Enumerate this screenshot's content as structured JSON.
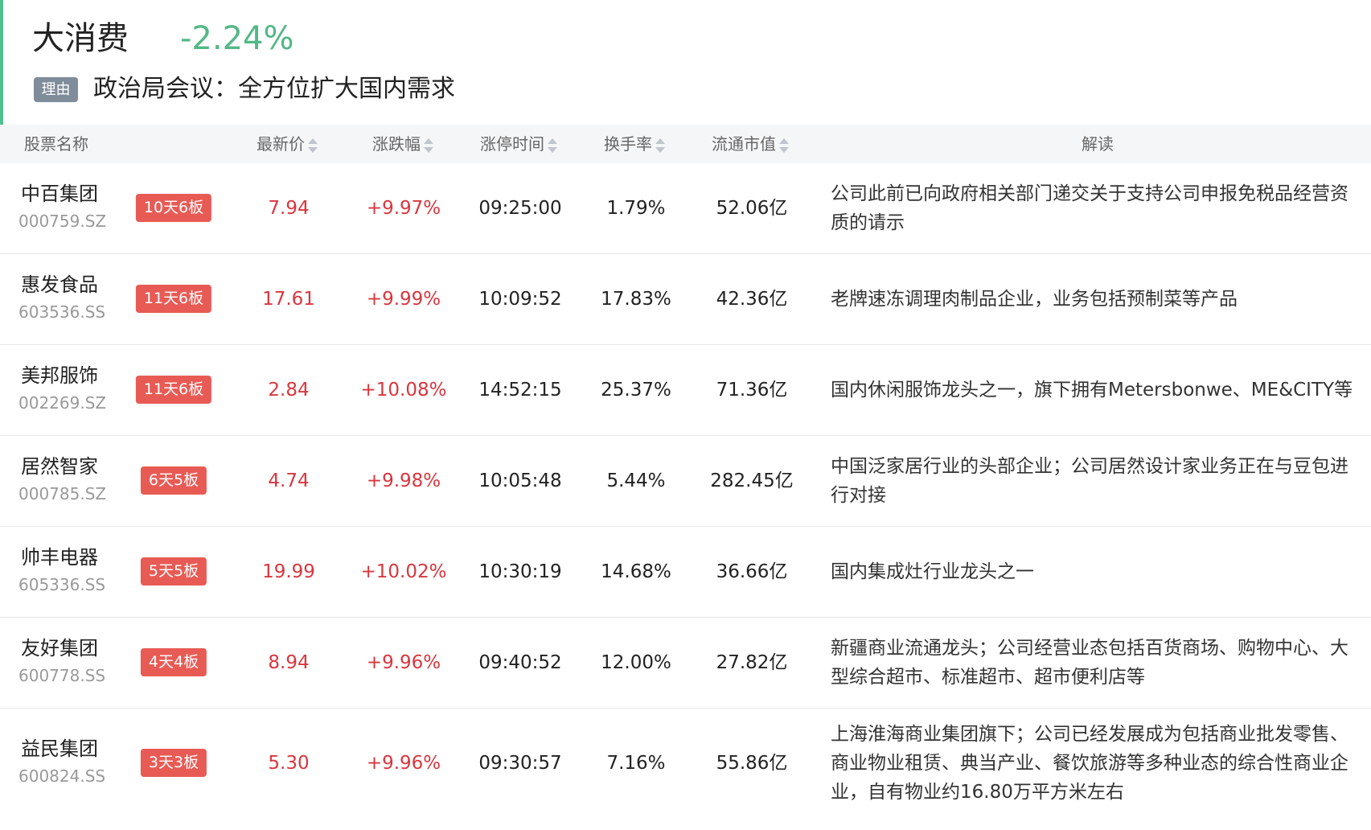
{
  "header": {
    "title": "大消费",
    "change": "-2.24%",
    "reason_tag": "理由",
    "reason": "政治局会议：全方位扩大国内需求"
  },
  "colors": {
    "accent_green": "#4fc08d",
    "down_green": "#52b886",
    "up_red": "#d9363e",
    "badge_red": "#e85b55",
    "tag_gray": "#7f8c9a"
  },
  "table": {
    "columns": {
      "name": "股票名称",
      "price": "最新价",
      "change": "涨跌幅",
      "limit_time": "涨停时间",
      "turnover": "换手率",
      "float_cap": "流通市值",
      "explain": "解读"
    },
    "rows": [
      {
        "name": "中百集团",
        "code": "000759.SZ",
        "badge": "10天6板",
        "price": "7.94",
        "change": "+9.97%",
        "limit_time": "09:25:00",
        "turnover": "1.79%",
        "float_cap": "52.06亿",
        "explain": "公司此前已向政府相关部门递交关于支持公司申报免税品经营资质的请示"
      },
      {
        "name": "惠发食品",
        "code": "603536.SS",
        "badge": "11天6板",
        "price": "17.61",
        "change": "+9.99%",
        "limit_time": "10:09:52",
        "turnover": "17.83%",
        "float_cap": "42.36亿",
        "explain": "老牌速冻调理肉制品企业，业务包括预制菜等产品"
      },
      {
        "name": "美邦服饰",
        "code": "002269.SZ",
        "badge": "11天6板",
        "price": "2.84",
        "change": "+10.08%",
        "limit_time": "14:52:15",
        "turnover": "25.37%",
        "float_cap": "71.36亿",
        "explain": "国内休闲服饰龙头之一，旗下拥有Metersbonwe、ME&CITY等"
      },
      {
        "name": "居然智家",
        "code": "000785.SZ",
        "badge": "6天5板",
        "price": "4.74",
        "change": "+9.98%",
        "limit_time": "10:05:48",
        "turnover": "5.44%",
        "float_cap": "282.45亿",
        "explain": "中国泛家居行业的头部企业；公司居然设计家业务正在与豆包进行对接"
      },
      {
        "name": "帅丰电器",
        "code": "605336.SS",
        "badge": "5天5板",
        "price": "19.99",
        "change": "+10.02%",
        "limit_time": "10:30:19",
        "turnover": "14.68%",
        "float_cap": "36.66亿",
        "explain": "国内集成灶行业龙头之一"
      },
      {
        "name": "友好集团",
        "code": "600778.SS",
        "badge": "4天4板",
        "price": "8.94",
        "change": "+9.96%",
        "limit_time": "09:40:52",
        "turnover": "12.00%",
        "float_cap": "27.82亿",
        "explain": "新疆商业流通龙头；公司经营业态包括百货商场、购物中心、大型综合超市、标准超市、超市便利店等"
      },
      {
        "name": "益民集团",
        "code": "600824.SS",
        "badge": "3天3板",
        "price": "5.30",
        "change": "+9.96%",
        "limit_time": "09:30:57",
        "turnover": "7.16%",
        "float_cap": "55.86亿",
        "explain": "上海淮海商业集团旗下；公司已经发展成为包括商业批发零售、商业物业租赁、典当产业、餐饮旅游等多种业态的综合性商业企业，自有物业约16.80万平方米左右"
      }
    ]
  }
}
